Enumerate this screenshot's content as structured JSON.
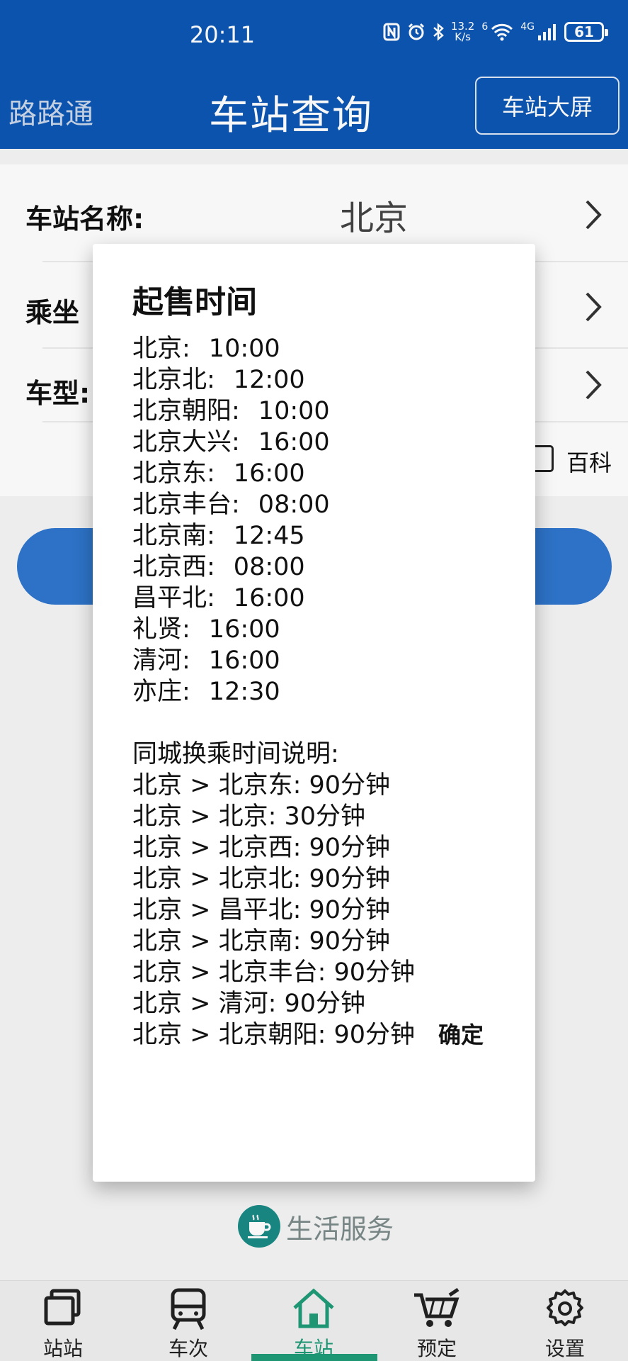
{
  "status_bar": {
    "time": "20:11",
    "net_speed_top": "13.2",
    "net_speed_bottom": "K/s",
    "wifi_label": "6",
    "signal_label": "4G",
    "battery": "61"
  },
  "header": {
    "app_name": "路路通",
    "title": "车站查询",
    "big_screen_button": "车站大屏"
  },
  "form": {
    "station_label": "车站名称:",
    "station_value": "北京",
    "ride_label": "乘坐",
    "type_label": "车型:",
    "baike_label": "百科"
  },
  "life_service": "生活服务",
  "dialog": {
    "title": "起售时间",
    "sale_times": [
      {
        "station": "北京:",
        "time": "10:00"
      },
      {
        "station": "北京北:",
        "time": "12:00"
      },
      {
        "station": "北京朝阳:",
        "time": "10:00"
      },
      {
        "station": "北京大兴:",
        "time": "16:00"
      },
      {
        "station": "北京东:",
        "time": "16:00"
      },
      {
        "station": "北京丰台:",
        "time": "08:00"
      },
      {
        "station": "北京南:",
        "time": "12:45"
      },
      {
        "station": "北京西:",
        "time": "08:00"
      },
      {
        "station": "昌平北:",
        "time": "16:00"
      },
      {
        "station": "礼贤:",
        "time": "16:00"
      },
      {
        "station": "清河:",
        "time": "16:00"
      },
      {
        "station": "亦庄:",
        "time": "12:30"
      }
    ],
    "transfer_heading": "同城换乘时间说明:",
    "transfers": [
      "北京 > 北京东: 90分钟",
      "北京 > 北京: 30分钟",
      "北京 > 北京西: 90分钟",
      "北京 > 北京北: 90分钟",
      "北京 > 昌平北: 90分钟",
      "北京 > 北京南: 90分钟",
      "北京 > 北京丰台: 90分钟",
      "北京 > 清河: 90分钟",
      "北京 > 北京朝阳: 90分钟"
    ],
    "confirm": "确定"
  },
  "bottom_nav": [
    {
      "label": "站站",
      "icon": "station-pair-icon"
    },
    {
      "label": "车次",
      "icon": "train-icon"
    },
    {
      "label": "车站",
      "icon": "home-station-icon"
    },
    {
      "label": "预定",
      "icon": "cart-icon"
    },
    {
      "label": "设置",
      "icon": "gear-icon"
    }
  ],
  "colors": {
    "primary": "#0d56b4",
    "button": "#2f76cd",
    "active_tab": "#1f9a77"
  }
}
